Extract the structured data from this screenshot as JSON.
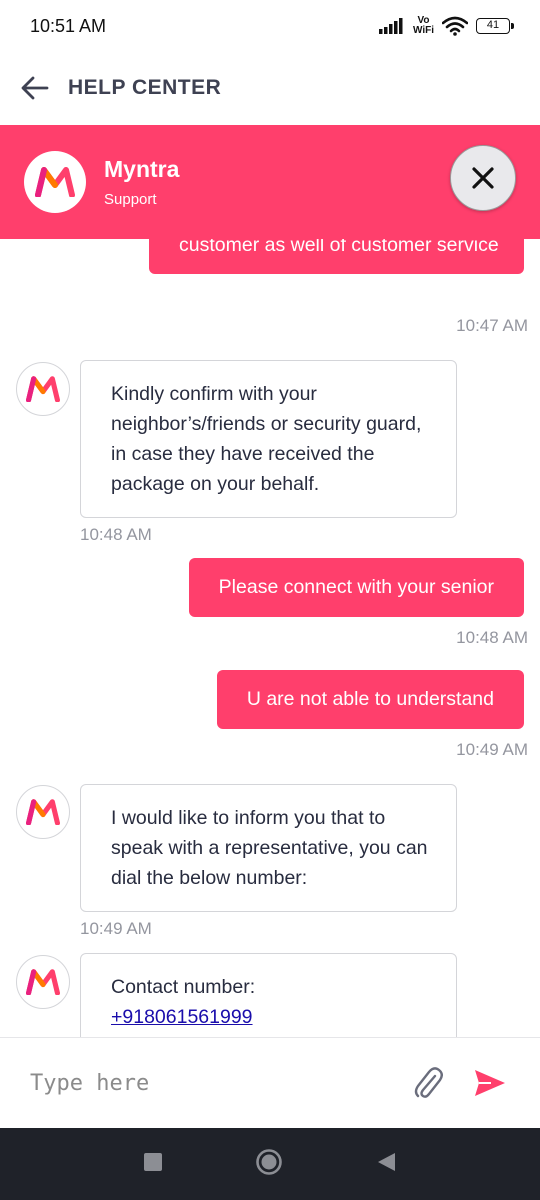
{
  "status_bar": {
    "time": "10:51 AM",
    "vowifi_top": "Vo",
    "vowifi_bottom": "WiFi",
    "battery": "41"
  },
  "header": {
    "title": "HELP CENTER"
  },
  "brand": {
    "name": "Myntra",
    "subtitle": "Support",
    "accent_color": "#ff3f6c"
  },
  "messages": [
    {
      "sender": "user",
      "text": "customer as well of customer service",
      "time": "10:47 AM"
    },
    {
      "sender": "agent",
      "text": "Kindly confirm with your neighbor’s/friends or security guard, in case they have received the package on your behalf.",
      "time": "10:48 AM"
    },
    {
      "sender": "user",
      "text": "Please connect with your senior",
      "time": "10:48 AM"
    },
    {
      "sender": "user",
      "text": "U are not able to understand",
      "time": "10:49 AM"
    },
    {
      "sender": "agent",
      "text": "I would like to inform you that to speak with a representative, you can dial the below number:",
      "time": "10:49 AM"
    },
    {
      "sender": "agent",
      "label": "Contact number:",
      "link": "+918061561999"
    }
  ],
  "input": {
    "placeholder": "Type here"
  }
}
